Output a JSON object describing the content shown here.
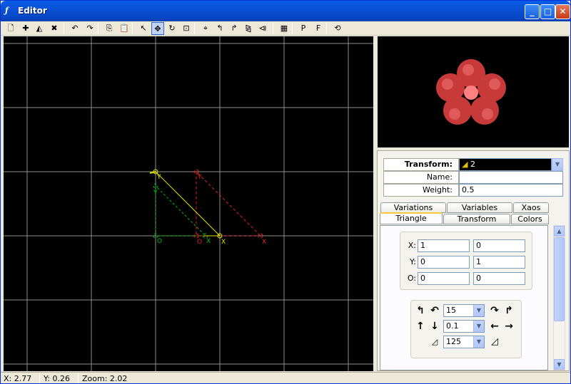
{
  "window": {
    "title": "Editor",
    "app_icon": "ƒ"
  },
  "title_buttons": {
    "minimize": "_",
    "maximize": "□",
    "close": "✕"
  },
  "toolbar": {
    "icons": [
      "new-icon",
      "add-transform-icon",
      "duplicate-icon",
      "delete-icon",
      "undo-icon",
      "redo-icon",
      "copy-icon",
      "paste-icon",
      "select-icon",
      "move-icon",
      "rotate-icon",
      "scale-icon",
      "center-icon",
      "rotate-left-icon",
      "rotate-right-icon",
      "flip-h-icon",
      "flip-v-icon",
      "grid-icon",
      "pre-icon",
      "post-icon",
      "reset-icon"
    ],
    "glyphs": [
      "🗋",
      "✚",
      "◭",
      "✖",
      "↶",
      "↷",
      "⎘",
      "📋",
      "↖",
      "✥",
      "↻",
      "⊡",
      "⌖",
      "↰",
      "↱",
      "⧎",
      "⧏",
      "▦",
      "P",
      "F",
      "⟲"
    ]
  },
  "canvas": {
    "triangles": [
      {
        "name": "green",
        "color": "#00c000",
        "labels": [
          "O",
          "X",
          "Y"
        ]
      },
      {
        "name": "yellow",
        "color": "#e0e000",
        "labels": [
          "X",
          "Y"
        ]
      },
      {
        "name": "red",
        "color": "#e02020",
        "labels": [
          "O",
          "X",
          "Y"
        ]
      }
    ]
  },
  "preview": {
    "color": "#e85050"
  },
  "properties": {
    "transform_label": "Transform:",
    "transform_value": "2",
    "name_label": "Name:",
    "name_value": "",
    "weight_label": "Weight:",
    "weight_value": "0.5"
  },
  "tabs": {
    "row1": [
      "Variations",
      "Variables",
      "Xaos"
    ],
    "row2": [
      "Triangle",
      "Transform",
      "Colors"
    ],
    "selected": "Triangle"
  },
  "triangle": {
    "x_label": "X:",
    "x1": "1",
    "x2": "0",
    "y_label": "Y:",
    "y1": "0",
    "y2": "1",
    "o_label": "O:",
    "o1": "0",
    "o2": "0",
    "rotate_value": "15",
    "move_value": "0.1",
    "scale_value": "125"
  },
  "status": {
    "x": "X: 2.77",
    "y": "Y: 0.26",
    "zoom": "Zoom: 2.02"
  }
}
